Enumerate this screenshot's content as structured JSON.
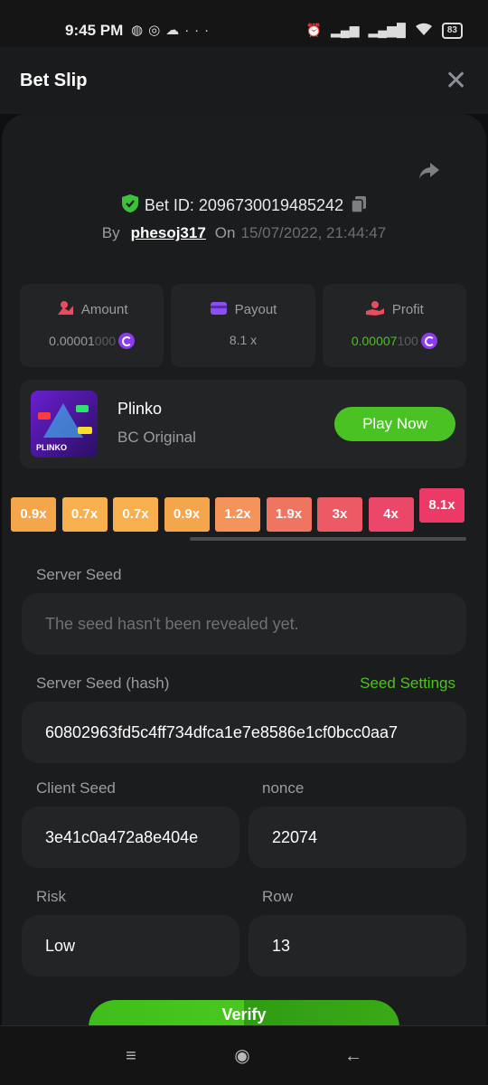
{
  "status_bar": {
    "time": "9:45 PM",
    "battery": "83",
    "icons": [
      "messenger-icon",
      "whatsapp-icon",
      "cloud-icon",
      "more-icon",
      "alarm-icon",
      "signal-icon",
      "signal-icon",
      "wifi-icon",
      "battery-icon"
    ]
  },
  "header": {
    "title": "Bet Slip",
    "close_label": "✕"
  },
  "bet": {
    "id_text": "Bet ID: 2096730019485242",
    "by_label": "By",
    "user": "phesoj317",
    "on_label": "On",
    "date": "15/07/2022, 21:44:47"
  },
  "stats": {
    "amount": {
      "label": "Amount",
      "value_main": "0.00001",
      "value_dim": "000"
    },
    "payout": {
      "label": "Payout",
      "value": "8.1 x"
    },
    "profit": {
      "label": "Profit",
      "value_main": "0.00007",
      "value_dim": "100"
    }
  },
  "game": {
    "name": "Plinko",
    "subtitle": "BC Original",
    "thumb_label": "PLINKO",
    "play_label": "Play Now"
  },
  "multipliers": [
    {
      "label": "0.9x",
      "color": "#f5a54a",
      "hit": false
    },
    {
      "label": "0.7x",
      "color": "#f8b04e",
      "hit": false
    },
    {
      "label": "0.7x",
      "color": "#f8b04e",
      "hit": false
    },
    {
      "label": "0.9x",
      "color": "#f5a54a",
      "hit": false
    },
    {
      "label": "1.2x",
      "color": "#f4935a",
      "hit": false
    },
    {
      "label": "1.9x",
      "color": "#f07561",
      "hit": false
    },
    {
      "label": "3x",
      "color": "#ec5a66",
      "hit": false
    },
    {
      "label": "4x",
      "color": "#eb4768",
      "hit": false
    },
    {
      "label": "8.1x",
      "color": "#ec3a66",
      "hit": true
    }
  ],
  "fields": {
    "server_seed_label": "Server Seed",
    "server_seed_placeholder": "The seed hasn't been revealed yet.",
    "server_hash_label": "Server Seed (hash)",
    "seed_settings": "Seed Settings",
    "server_hash": "60802963fd5c4ff734dfca1e7e8586e1cf0bcc0aa7",
    "client_seed_label": "Client Seed",
    "client_seed": "3e41c0a472a8e404e",
    "nonce_label": "nonce",
    "nonce": "22074",
    "risk_label": "Risk",
    "risk": "Low",
    "row_label": "Row",
    "row": "13"
  },
  "verify_label": "Verify",
  "colors": {
    "accent_green": "#4ac223",
    "card_bg": "#1b1c1e",
    "field_bg": "#232426",
    "coin": "#8c3bf0"
  }
}
